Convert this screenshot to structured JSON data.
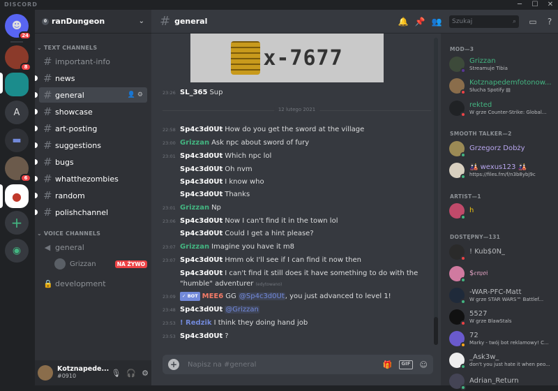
{
  "window": {
    "brand": "DISCORD"
  },
  "guilds": {
    "home_badge": "24",
    "g2_badge": "8",
    "letter": "A",
    "g6_badge": "6"
  },
  "server": {
    "shield": "0",
    "name": "ranDungeon"
  },
  "categories": {
    "text": "TEXT CHANNELS",
    "voice": "VOICE CHANNELS"
  },
  "text_channels": [
    {
      "label": "important-info"
    },
    {
      "label": "news"
    },
    {
      "label": "general"
    },
    {
      "label": "showcase"
    },
    {
      "label": "art-posting"
    },
    {
      "label": "suggestions"
    },
    {
      "label": "bugs"
    },
    {
      "label": "whatthezombies"
    },
    {
      "label": "random"
    },
    {
      "label": "polishchannel"
    }
  ],
  "voice_channels": [
    {
      "label": "general"
    },
    {
      "label": "development"
    }
  ],
  "voice_user": {
    "name": "Grizzan",
    "live": "NA ŻYWO"
  },
  "user_panel": {
    "name": "Kotznapede...",
    "tag": "#0910"
  },
  "header": {
    "channel": "general",
    "search_placeholder": "Szukaj"
  },
  "embed_text": "x-7677",
  "date_divider": "12 lutego 2021",
  "messages": [
    {
      "ts": "23:26",
      "name": "SL_365",
      "text": "Sup"
    },
    {
      "ts": "22:58",
      "name": "Sp4c3d0Ut",
      "text": "How do you get the sword at the village"
    },
    {
      "ts": "23:00",
      "name": "Grizzan",
      "text": "Ask npc about sword of fury"
    },
    {
      "ts": "23:01",
      "name": "Sp4c3d0Ut",
      "text": "Which npc lol"
    },
    {
      "ts": "",
      "name": "Sp4c3d0Ut",
      "text": "Oh nvm"
    },
    {
      "ts": "",
      "name": "Sp4c3d0Ut",
      "text": "I know who"
    },
    {
      "ts": "",
      "name": "Sp4c3d0Ut",
      "text": "Thanks"
    },
    {
      "ts": "23:01",
      "name": "Grizzan",
      "text": "Np"
    },
    {
      "ts": "23:06",
      "name": "Sp4c3d0Ut",
      "text": "Now I can't find it in the town lol"
    },
    {
      "ts": "",
      "name": "Sp4c3d0Ut",
      "text": "Could I get a hint please?"
    },
    {
      "ts": "23:07",
      "name": "Grizzan",
      "text": "Imagine you have it m8"
    },
    {
      "ts": "23:07",
      "name": "Sp4c3d0Ut",
      "text": "Hmm ok I'll see if I can find it now then"
    },
    {
      "ts": "",
      "name": "Sp4c3d0Ut",
      "text": "I can't find it still does it have something to do with the \"humble\" adventurer",
      "edited": "(edytowano)"
    },
    {
      "ts": "23:09",
      "bot": "✓ BOT",
      "name": "MEE6",
      "pre": "GG",
      "mention": "@Sp4c3d0Ut",
      "text": ", you just advanced to level 1!"
    },
    {
      "ts": "23:48",
      "name": "Sp4c3d0Ut",
      "mention": "@Grizzan",
      "text": ""
    },
    {
      "ts": "23:53",
      "name": "! Redzik",
      "text": "I think they doing hand job"
    },
    {
      "ts": "23:53",
      "name": "Sp4c3d0Ut",
      "text": "?"
    }
  ],
  "input": {
    "placeholder": "Napisz na #general"
  },
  "member_groups": [
    {
      "title": "MOD—3"
    },
    {
      "title": "SMOOTH TALKER—2"
    },
    {
      "title": "ARTIST—1"
    },
    {
      "title": "DOSTĘPNY—131"
    }
  ],
  "members": [
    {
      "name": "Grizzan",
      "sub": "Streamuje Tibia"
    },
    {
      "name": "Kotznapedemfotonow...",
      "sub": "Słucha Spotify ▤"
    },
    {
      "name": "rekted",
      "sub": "W grze Counter-Strike: Global..."
    },
    {
      "name": "Grzegorz Dobży",
      "sub": ""
    },
    {
      "name": "🎎 wexus123 🎎",
      "sub": "https://files.fm/f/n3b8ybj9c"
    },
    {
      "name": "h",
      "sub": ""
    },
    {
      "name": "! Kub$0N_",
      "sub": ""
    },
    {
      "name": "$𝔢𝔫𝔭𝔬𝔦",
      "sub": ""
    },
    {
      "name": "-WAR-PFC-Matt",
      "sub": "W grze STAR WARS™ Battlef..."
    },
    {
      "name": "5527",
      "sub": "W grze BlawStals"
    },
    {
      "name": "72",
      "sub": "Marky - twój bot reklamowy! C..."
    },
    {
      "name": "_Ask3w_",
      "sub": "don't you just hate it when peo..."
    },
    {
      "name": "Adrian_Return",
      "sub": ""
    }
  ]
}
